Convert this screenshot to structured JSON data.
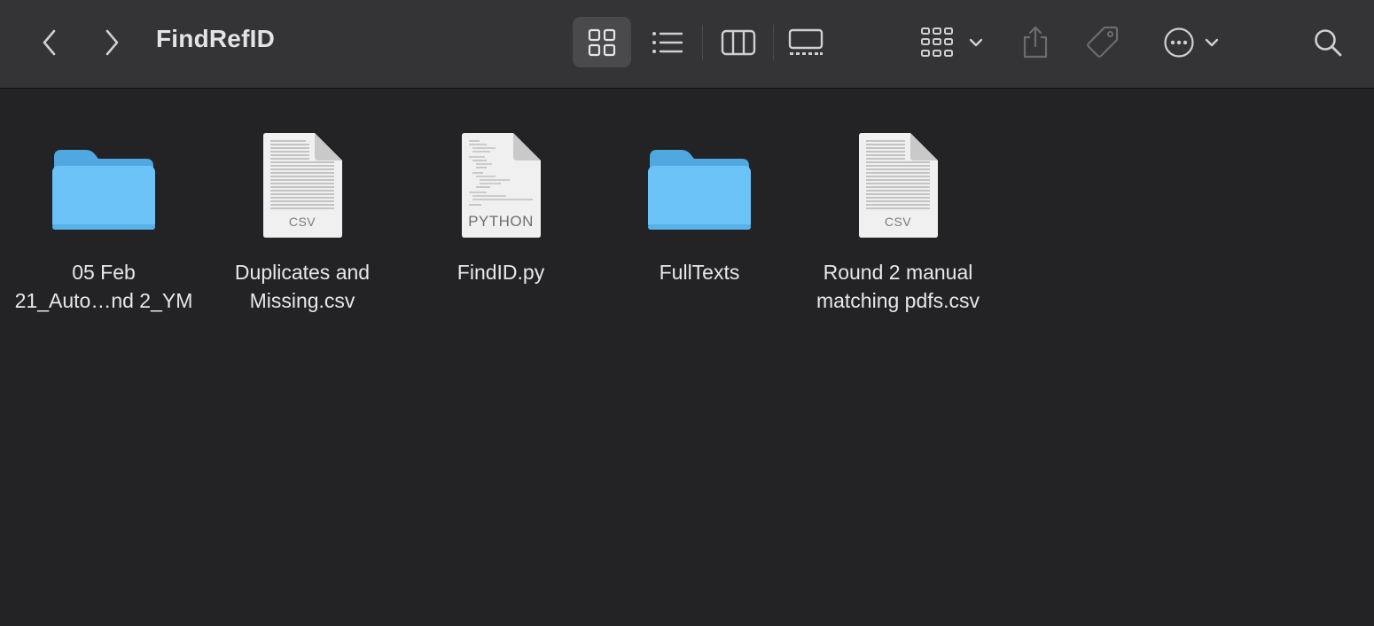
{
  "window": {
    "title": "FindRefID"
  },
  "toolbar": {
    "back": "chevron-left-icon",
    "forward": "chevron-right-icon",
    "view_modes": [
      "icon-view",
      "list-view",
      "column-view",
      "gallery-view"
    ],
    "active_view": "icon-view",
    "group": "group-by-icon",
    "share": "share-icon",
    "tag": "tag-icon",
    "action": "more-actions-icon",
    "search": "search-icon"
  },
  "files": [
    {
      "label": "05 Feb\n21_Auto…nd 2_YM",
      "kind": "folder",
      "badge": ""
    },
    {
      "label": "Duplicates and\nMissing.csv",
      "kind": "doc",
      "badge": "CSV"
    },
    {
      "label": "FindID.py",
      "kind": "doc",
      "badge": "PYTHON"
    },
    {
      "label": "FullTexts",
      "kind": "folder",
      "badge": ""
    },
    {
      "label": "Round 2 manual\nmatching pdfs.csv",
      "kind": "doc",
      "badge": "CSV"
    }
  ],
  "colors": {
    "folder_body": "#6cc3f7",
    "folder_tab": "#4fa8e0",
    "toolbar_bg": "#343336",
    "content_bg": "#232225"
  }
}
